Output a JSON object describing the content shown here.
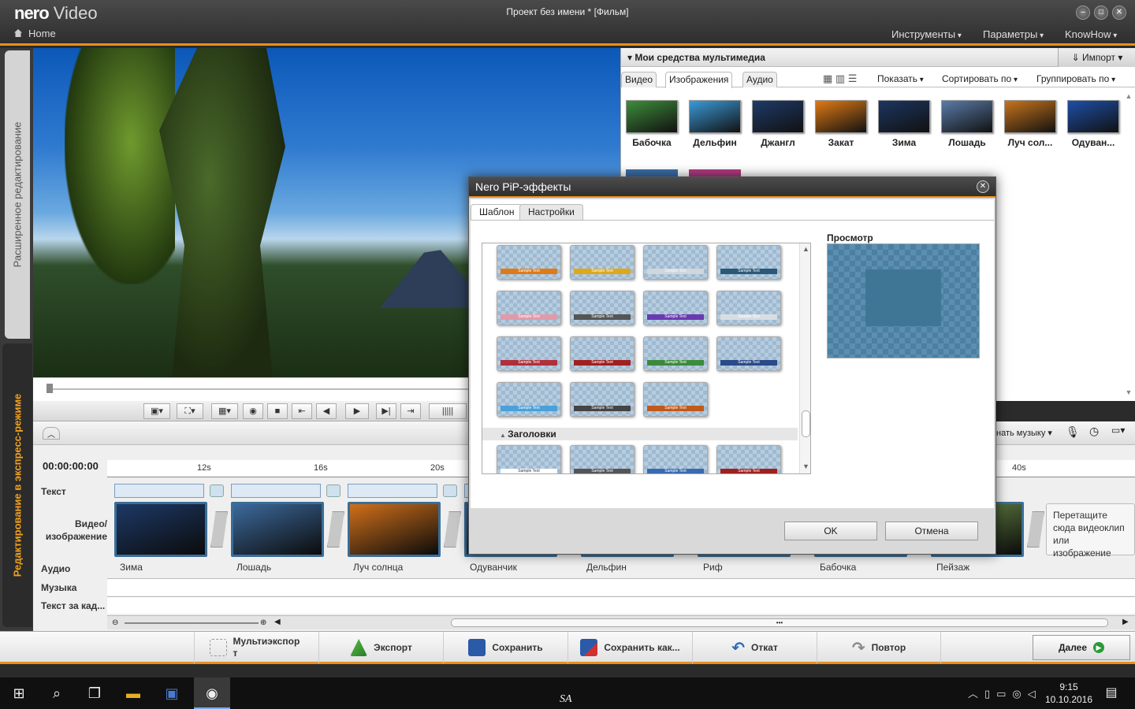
{
  "app": {
    "brand": "nero",
    "product": "Video",
    "home": "Home",
    "window_title": "Проект без имени * [Фильм]"
  },
  "menu": [
    "Инструменты",
    "Параметры",
    "KnowHow"
  ],
  "rail": {
    "advanced": "Расширенное редактирование",
    "express": "Редактирование в экспресс-режиме"
  },
  "media": {
    "title": "Мои средства мультимедиа",
    "import": "Импорт",
    "tabs": [
      "Видео",
      "Изображения",
      "Аудио"
    ],
    "options": [
      "Показать",
      "Сортировать по",
      "Группировать по"
    ],
    "thumbs": [
      {
        "label": "Бабочка",
        "color": "#3e8d3a"
      },
      {
        "label": "Дельфин",
        "color": "#3b9ad8"
      },
      {
        "label": "Джангл",
        "color": "#1e3a68"
      },
      {
        "label": "Закат",
        "color": "#e07a14"
      },
      {
        "label": "Зима",
        "color": "#1c3560"
      },
      {
        "label": "Лошадь",
        "color": "#5a7ba8"
      },
      {
        "label": "Луч сол...",
        "color": "#c8741c"
      },
      {
        "label": "Одуван...",
        "color": "#1d4fa8"
      }
    ]
  },
  "dialog": {
    "title": "Nero PiP-эффекты",
    "tabs": [
      "Шаблон",
      "Настройки"
    ],
    "group": "Заголовки",
    "sample": "Sample Text",
    "preview_label": "Просмотр",
    "ok": "OK",
    "cancel": "Отмена"
  },
  "timeline": {
    "timecode": "00:00:00:00",
    "ticks": [
      "12s",
      "16s",
      "20s",
      "40s"
    ],
    "tracks": {
      "text": "Текст",
      "video": "Видео/\nизображение",
      "audio": "Аудио",
      "music": "Музыка",
      "caption": "Текст за кад..."
    },
    "find_music": "нать музыку",
    "clips": [
      {
        "label": "Зима",
        "color": "#1d3966"
      },
      {
        "label": "Лошадь",
        "color": "#3d6a9c"
      },
      {
        "label": "Луч солнца",
        "color": "#d0701a"
      },
      {
        "label": "Одуванчик",
        "color": "#2f5e98"
      },
      {
        "label": "Дельфин",
        "color": "#3b90c8"
      },
      {
        "label": "Риф",
        "color": "#2a6e8e"
      },
      {
        "label": "Бабочка",
        "color": "#3c8a3a"
      },
      {
        "label": "Пейзаж",
        "color": "#6b8f4a"
      }
    ],
    "drop_hint": "Перетащите сюда видеоклип или изображение"
  },
  "bottom": {
    "multiexport": "Мультиэкспор т",
    "export": "Экспорт",
    "save": "Сохранить",
    "save_as": "Сохранить как...",
    "undo": "Откат",
    "redo": "Повтор",
    "next": "Далее"
  },
  "taskbar": {
    "time": "9:15",
    "date": "10.10.2016",
    "sa": "SA"
  },
  "colors": {
    "accent": "#e8901c"
  }
}
